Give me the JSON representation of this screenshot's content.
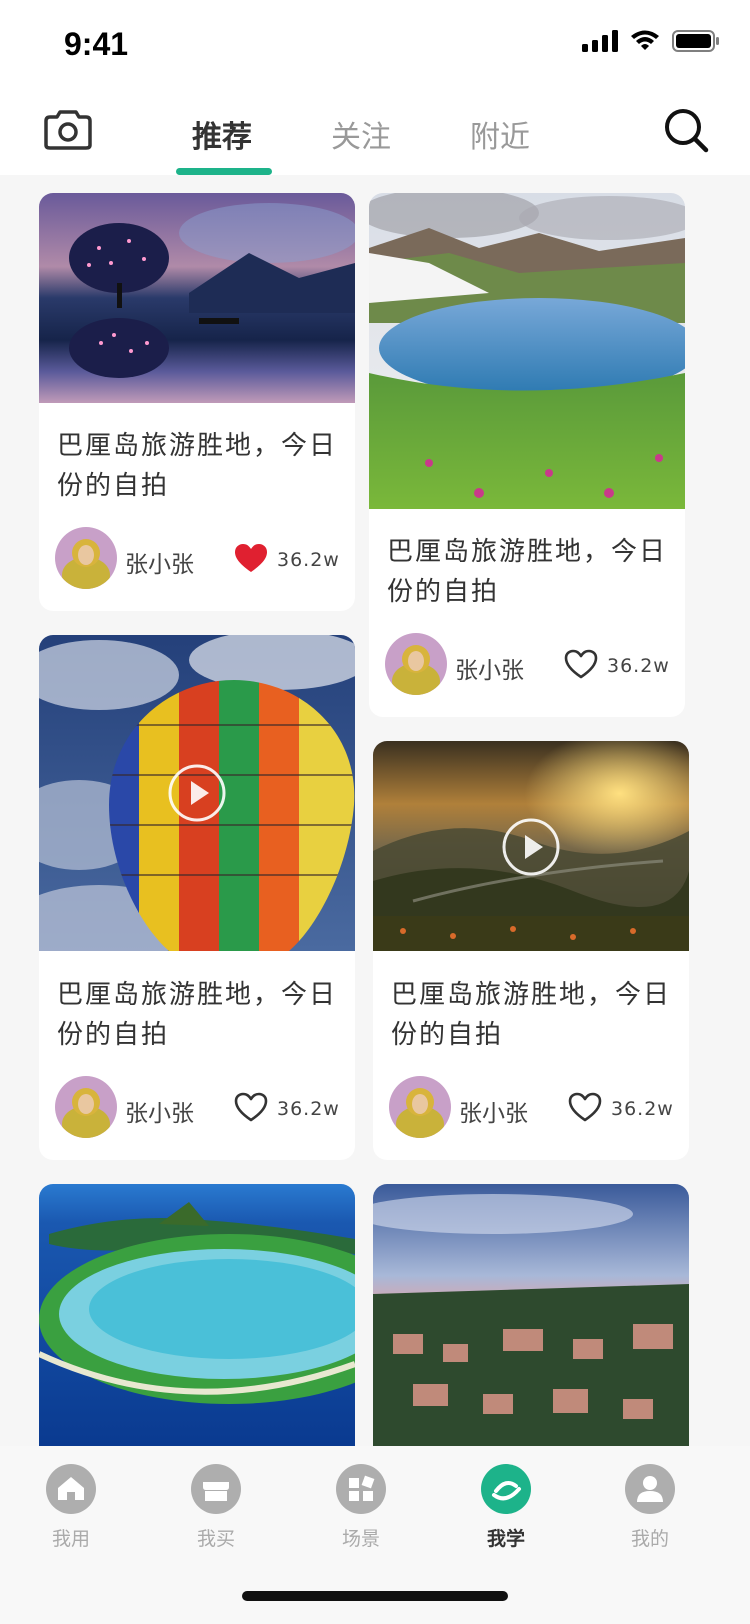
{
  "status": {
    "time": "9:41"
  },
  "nav": {
    "tabs": [
      {
        "label": "推荐",
        "active": true
      },
      {
        "label": "关注",
        "active": false
      },
      {
        "label": "附近",
        "active": false
      }
    ],
    "accent": "#1db38a"
  },
  "cards": [
    {
      "title": "巴厘岛旅游胜地，今日份的自拍",
      "author": "张小张",
      "likes": "36.2w",
      "liked": true,
      "has_video": false,
      "image": "starry tree reflection"
    },
    {
      "title": "巴厘岛旅游胜地，今日份的自拍",
      "author": "张小张",
      "likes": "36.2w",
      "liked": false,
      "has_video": false,
      "image": "mountain lake"
    },
    {
      "title": "巴厘岛旅游胜地，今日份的自拍",
      "author": "张小张",
      "likes": "36.2w",
      "liked": false,
      "has_video": true,
      "image": "hot air balloon"
    },
    {
      "title": "巴厘岛旅游胜地，今日份的自拍",
      "author": "张小张",
      "likes": "36.2w",
      "liked": false,
      "has_video": true,
      "image": "sunset valley"
    },
    {
      "image": "tropical island"
    },
    {
      "image": "hill town sunset"
    }
  ],
  "tabbar": {
    "items": [
      {
        "label": "我用",
        "icon": "home-icon",
        "active": false
      },
      {
        "label": "我买",
        "icon": "shop-icon",
        "active": false
      },
      {
        "label": "场景",
        "icon": "grid-icon",
        "active": false
      },
      {
        "label": "我学",
        "icon": "planet-icon",
        "active": true
      },
      {
        "label": "我的",
        "icon": "user-icon",
        "active": false
      }
    ]
  },
  "colors": {
    "accent": "#1db38a",
    "heart_active": "#e02030"
  }
}
